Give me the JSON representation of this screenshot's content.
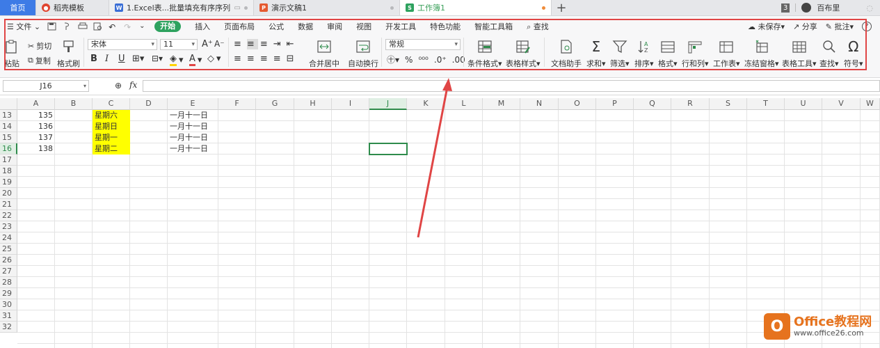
{
  "tabs": {
    "home": "首页",
    "t1": "稻壳模板",
    "t2": "1.Excel表...批量填充有序序列",
    "t3": "演示文稿1",
    "t4": "工作簿1",
    "plus": "+",
    "count": "3",
    "user": "百布里"
  },
  "menu": {
    "file": "文件",
    "items": [
      "开始",
      "插入",
      "页面布局",
      "公式",
      "数据",
      "审阅",
      "视图",
      "开发工具",
      "特色功能",
      "智能工具箱",
      "查找"
    ],
    "unsaved": "未保存",
    "share": "分享",
    "comment": "批注"
  },
  "toolbar": {
    "paste": "粘贴",
    "cut": "剪切",
    "copy": "复制",
    "format_painter": "格式刷",
    "font_name": "宋体",
    "font_size": "11",
    "merge": "合并居中",
    "wrap": "自动换行",
    "number_format": "常规",
    "conditional": "条件格式",
    "table_style": "表格样式",
    "doc_helper": "文档助手",
    "sum": "求和",
    "filter": "筛选",
    "sort": "排序",
    "format": "格式",
    "row_col": "行和列",
    "worksheet": "工作表",
    "freeze": "冻结窗格",
    "table_tools": "表格工具",
    "find": "查找",
    "symbol": "符号"
  },
  "formula_bar": {
    "name_box": "J16",
    "fx": "fx",
    "value": ""
  },
  "sheet": {
    "columns": [
      "A",
      "B",
      "C",
      "D",
      "E",
      "F",
      "G",
      "H",
      "I",
      "J",
      "K",
      "L",
      "M",
      "N",
      "O",
      "P",
      "Q",
      "R",
      "S",
      "T",
      "U",
      "V",
      "W"
    ],
    "rows": [
      "13",
      "14",
      "15",
      "16",
      "17",
      "18",
      "19",
      "20",
      "21",
      "22",
      "23",
      "24",
      "25",
      "26",
      "27",
      "28",
      "29",
      "30",
      "31",
      "32"
    ],
    "active_cell": "J16",
    "data": [
      {
        "a": "135",
        "c": "星期六",
        "e": "一月十一日"
      },
      {
        "a": "136",
        "c": "星期日",
        "e": "一月十一日"
      },
      {
        "a": "137",
        "c": "星期一",
        "e": "一月十一日"
      },
      {
        "a": "138",
        "c": "星期二",
        "e": "一月十一日"
      }
    ]
  },
  "watermark": {
    "line1": "Office教程网",
    "line2": "www.office26.com"
  },
  "colors": {
    "highlight": "#ffff00",
    "accent_green": "#2ea25f",
    "annotation_red": "#e04545",
    "home_tab": "#3d7be6"
  }
}
